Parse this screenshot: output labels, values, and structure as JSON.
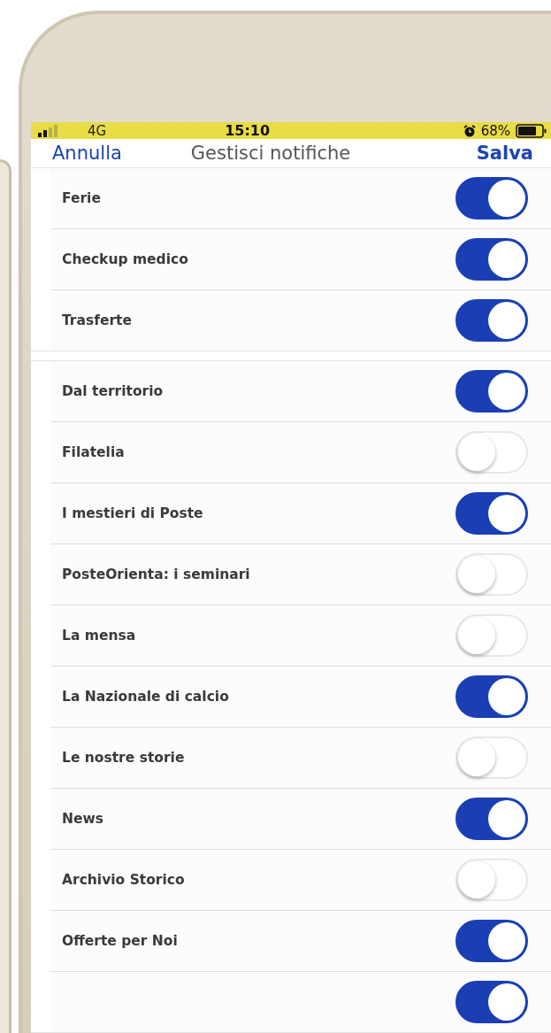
{
  "status_bar": {
    "network": "4G",
    "time": "15:10",
    "battery": "68%"
  },
  "nav": {
    "cancel": "Annulla",
    "title": "Gestisci notifiche",
    "save": "Salva"
  },
  "groups": [
    {
      "items": [
        {
          "label": "Ferie",
          "on": true
        },
        {
          "label": "Checkup medico",
          "on": true
        },
        {
          "label": "Trasferte",
          "on": true
        }
      ]
    },
    {
      "items": [
        {
          "label": "Dal territorio",
          "on": true
        },
        {
          "label": "Filatelia",
          "on": false
        },
        {
          "label": "I mestieri di Poste",
          "on": true
        },
        {
          "label": "PosteOrienta: i seminari",
          "on": false
        },
        {
          "label": "La mensa",
          "on": false
        },
        {
          "label": "La Nazionale di calcio",
          "on": true
        },
        {
          "label": "Le nostre storie",
          "on": false
        },
        {
          "label": "News",
          "on": true
        },
        {
          "label": "Archivio Storico",
          "on": false
        },
        {
          "label": "Offerte per Noi",
          "on": true
        },
        {
          "on": true
        }
      ]
    }
  ]
}
